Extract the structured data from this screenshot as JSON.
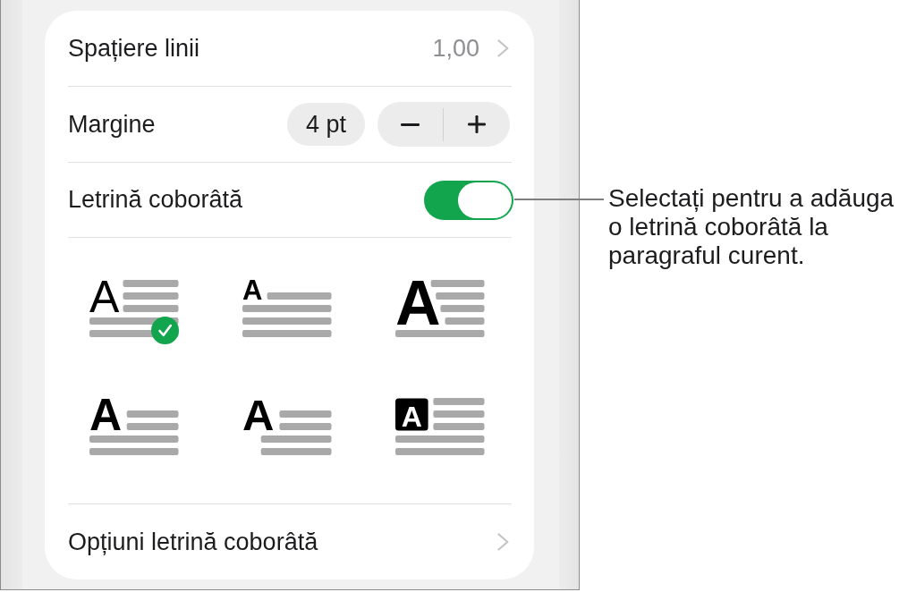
{
  "rows": [
    {
      "kind": "disclosure",
      "label": "Spațiere linii",
      "value": "1,00"
    },
    {
      "kind": "stepper",
      "label": "Margine",
      "value": "4 pt"
    },
    {
      "kind": "toggle",
      "label": "Letrină coborâtă",
      "on": true
    }
  ],
  "drop_cap_styles": [
    {
      "kind": "regular-three-line",
      "letter": "A",
      "selected": true
    },
    {
      "kind": "raised-small",
      "letter": "A",
      "selected": false
    },
    {
      "kind": "bold-four-line",
      "letter": "A",
      "selected": false
    },
    {
      "kind": "bold-two-line",
      "letter": "A",
      "selected": false
    },
    {
      "kind": "bold-hanging",
      "letter": "A",
      "selected": false
    },
    {
      "kind": "boxed",
      "letter": "A",
      "selected": false
    }
  ],
  "options_row": {
    "label": "Opțiuni letrină coborâtă"
  },
  "callout": {
    "text": "Selectați pentru a adăuga o letrină coborâtă la paragraful curent."
  }
}
